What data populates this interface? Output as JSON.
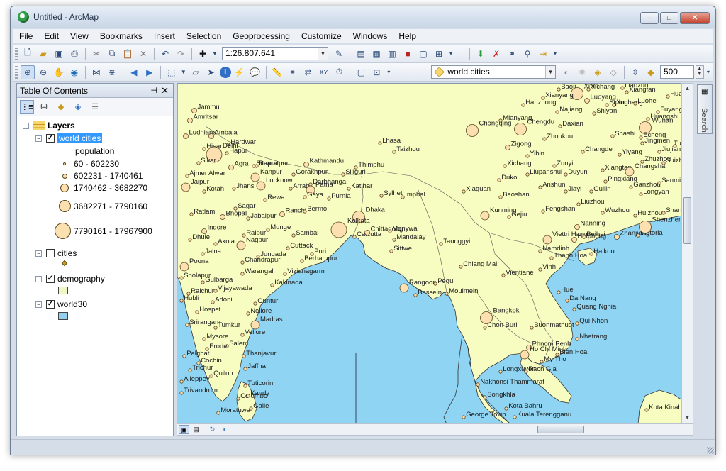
{
  "window": {
    "title": "Untitled - ArcMap",
    "minimize": "–",
    "maximize": "□",
    "close": "✕"
  },
  "menu": [
    "File",
    "Edit",
    "View",
    "Bookmarks",
    "Insert",
    "Selection",
    "Geoprocessing",
    "Customize",
    "Windows",
    "Help"
  ],
  "toolbar": {
    "scale": "1:26.807.641",
    "target_layer": "world cities",
    "snap_value": "500"
  },
  "toc": {
    "title": "Table Of Contents",
    "root": "Layers",
    "layers": [
      {
        "name": "world cities",
        "checked": true,
        "selected": true,
        "legend_title": "population",
        "classes": [
          "60 - 602230",
          "602231 - 1740461",
          "1740462 - 3682270",
          "3682271 - 7790160",
          "7790161 - 17967900"
        ]
      },
      {
        "name": "cities",
        "checked": false
      },
      {
        "name": "demography",
        "checked": true,
        "color": "#f0f7c4"
      },
      {
        "name": "world30",
        "checked": true,
        "color": "#96ceef"
      }
    ]
  },
  "search_tab": "Search",
  "colors": {
    "land": "#f7fcc0",
    "water": "#8fd4f2",
    "city_fill": "#fde0b0",
    "city_outline": "#5b4420",
    "boundary": "#333333"
  },
  "map_cities": [
    {
      "name": "Jammu",
      "size": 1
    },
    {
      "name": "Amritsar",
      "size": 1
    },
    {
      "name": "Ludhiana",
      "size": 1
    },
    {
      "name": "Ambala",
      "size": 1
    },
    {
      "name": "Hardwar",
      "size": 0
    },
    {
      "name": "Hisar",
      "size": 0
    },
    {
      "name": "Hapur",
      "size": 0
    },
    {
      "name": "Delhi",
      "size": 4
    },
    {
      "name": "Agra",
      "size": 1
    },
    {
      "name": "Sikar",
      "size": 0
    },
    {
      "name": "Bharatpur",
      "size": 0
    },
    {
      "name": "Jaipur",
      "size": 2
    },
    {
      "name": "Ajmer Alwar",
      "size": 0
    },
    {
      "name": "Kotah",
      "size": 0
    },
    {
      "name": "Jhansi",
      "size": 0
    },
    {
      "name": "Kanpur",
      "size": 2
    },
    {
      "name": "Lucknow",
      "size": 2
    },
    {
      "name": "Gorakhpur",
      "size": 0
    },
    {
      "name": "Kathmandu",
      "size": 1
    },
    {
      "name": "Siliguri",
      "size": 0
    },
    {
      "name": "Thimphu",
      "size": 0
    },
    {
      "name": "Lhasa",
      "size": 0
    },
    {
      "name": "Taizhou",
      "size": 0
    },
    {
      "name": "Sitapur",
      "size": 0
    },
    {
      "name": "Arrah",
      "size": 0
    },
    {
      "name": "Darbhanga",
      "size": 0
    },
    {
      "name": "Patna",
      "size": 2
    },
    {
      "name": "Katihar",
      "size": 0
    },
    {
      "name": "Gaya",
      "size": 0
    },
    {
      "name": "Purnia",
      "size": 0
    },
    {
      "name": "Rewa",
      "size": 0
    },
    {
      "name": "Ranchi",
      "size": 1
    },
    {
      "name": "Bermo",
      "size": 0
    },
    {
      "name": "Sylhet",
      "size": 0
    },
    {
      "name": "Imphal",
      "size": 0
    },
    {
      "name": "Dhaka",
      "size": 3
    },
    {
      "name": "Kolkata",
      "size": 4
    },
    {
      "name": "Calcutta",
      "size": 0
    },
    {
      "name": "Chittagong",
      "size": 1
    },
    {
      "name": "Ratlam",
      "size": 0
    },
    {
      "name": "Bhopal",
      "size": 1
    },
    {
      "name": "Jabalpur",
      "size": 0
    },
    {
      "name": "Sagar",
      "size": 0
    },
    {
      "name": "Indore",
      "size": 1
    },
    {
      "name": "Raipur",
      "size": 0
    },
    {
      "name": "Munge",
      "size": 0
    },
    {
      "name": "Sambal",
      "size": 0
    },
    {
      "name": "Nagpur",
      "size": 2
    },
    {
      "name": "Akola",
      "size": 0
    },
    {
      "name": "Cuttack",
      "size": 0
    },
    {
      "name": "Jungada",
      "size": 0
    },
    {
      "name": "Puri",
      "size": 0
    },
    {
      "name": "Berhampur",
      "size": 0
    },
    {
      "name": "Chandrapur",
      "size": 0
    },
    {
      "name": "Dhule",
      "size": 0
    },
    {
      "name": "Jalna",
      "size": 0
    },
    {
      "name": "Poona",
      "size": 2
    },
    {
      "name": "Warangal",
      "size": 0
    },
    {
      "name": "Vizianagarm",
      "size": 0
    },
    {
      "name": "Sholapur",
      "size": 0
    },
    {
      "name": "Gulbarga",
      "size": 0
    },
    {
      "name": "Vijayawada",
      "size": 0
    },
    {
      "name": "Kakinada",
      "size": 0
    },
    {
      "name": "Raichur",
      "size": 0
    },
    {
      "name": "Guntur",
      "size": 0
    },
    {
      "name": "Hubli",
      "size": 0
    },
    {
      "name": "Adoni",
      "size": 0
    },
    {
      "name": "Nellore",
      "size": 0
    },
    {
      "name": "Hospet",
      "size": 0
    },
    {
      "name": "Madras",
      "size": 2
    },
    {
      "name": "Srirangam",
      "size": 0
    },
    {
      "name": "Tumkur",
      "size": 0
    },
    {
      "name": "Vellore",
      "size": 0
    },
    {
      "name": "Mysore",
      "size": 0
    },
    {
      "name": "Salem",
      "size": 0
    },
    {
      "name": "Erode",
      "size": 0
    },
    {
      "name": "Palghat",
      "size": 0
    },
    {
      "name": "Thanjavur",
      "size": 0
    },
    {
      "name": "Cochin",
      "size": 0
    },
    {
      "name": "Trichur",
      "size": 0
    },
    {
      "name": "Jaffna",
      "size": 0
    },
    {
      "name": "Quilon",
      "size": 0
    },
    {
      "name": "Alleppey",
      "size": 0
    },
    {
      "name": "Tuticorin",
      "size": 0
    },
    {
      "name": "Trivandrum",
      "size": 0
    },
    {
      "name": "Colombo",
      "size": 0
    },
    {
      "name": "Kandy",
      "size": 0
    },
    {
      "name": "Moratuwa",
      "size": 0
    },
    {
      "name": "Galle",
      "size": 0
    },
    {
      "name": "Monywa",
      "size": 0
    },
    {
      "name": "Mandalay",
      "size": 0
    },
    {
      "name": "Sittwe",
      "size": 0
    },
    {
      "name": "Taunggyi",
      "size": 0
    },
    {
      "name": "Rangoon",
      "size": 2
    },
    {
      "name": "Bassein",
      "size": 0
    },
    {
      "name": "Pegu",
      "size": 0
    },
    {
      "name": "Moulmein",
      "size": 0
    },
    {
      "name": "Chiang Mai",
      "size": 0
    },
    {
      "name": "Vientiane",
      "size": 0
    },
    {
      "name": "Bangkok",
      "size": 3
    },
    {
      "name": "Chon Buri",
      "size": 0
    },
    {
      "name": "Hue",
      "size": 0
    },
    {
      "name": "Da Nang",
      "size": 0
    },
    {
      "name": "Quang Nghia",
      "size": 0
    },
    {
      "name": "Qui Nhon",
      "size": 0
    },
    {
      "name": "Buonmathuot",
      "size": 0
    },
    {
      "name": "Nhatrang",
      "size": 0
    },
    {
      "name": "Phnom Penh",
      "size": 1
    },
    {
      "name": "Bien Hoa",
      "size": 0
    },
    {
      "name": "Ho Chi Minh",
      "size": 2
    },
    {
      "name": "My Tho",
      "size": 0
    },
    {
      "name": "Longxuyen",
      "size": 0
    },
    {
      "name": "Rach Gia",
      "size": 0
    },
    {
      "name": "Nakhonsi Thammarat",
      "size": 0
    },
    {
      "name": "Songkhla",
      "size": 0
    },
    {
      "name": "Kota Bahru",
      "size": 0
    },
    {
      "name": "Kuala Terengganu",
      "size": 0
    },
    {
      "name": "George Town",
      "size": 0
    },
    {
      "name": "Kota Kinabalu",
      "size": 0
    },
    {
      "name": "Viettri Hanoi",
      "size": 2
    },
    {
      "name": "Namdinh",
      "size": 0
    },
    {
      "name": "Haiphong",
      "size": 1
    },
    {
      "name": "Thanh Hoa",
      "size": 0
    },
    {
      "name": "Vinh",
      "size": 0
    },
    {
      "name": "Beihai",
      "size": 0
    },
    {
      "name": "Zhanjiang",
      "size": 1
    },
    {
      "name": "Haikou",
      "size": 0
    },
    {
      "name": "Victoria",
      "size": 0
    },
    {
      "name": "Kunming",
      "size": 2
    },
    {
      "name": "Gejiu",
      "size": 0
    },
    {
      "name": "Xiaguan",
      "size": 0
    },
    {
      "name": "Baoshan",
      "size": 0
    },
    {
      "name": "Dukou",
      "size": 0
    },
    {
      "name": "Xichang",
      "size": 0
    },
    {
      "name": "Zigong",
      "size": 1
    },
    {
      "name": "Yibin",
      "size": 0
    },
    {
      "name": "Chongqing",
      "size": 3
    },
    {
      "name": "Chengdu",
      "size": 3
    },
    {
      "name": "Mianyang",
      "size": 0
    },
    {
      "name": "Zhoukou",
      "size": 0
    },
    {
      "name": "Daxian",
      "size": 0
    },
    {
      "name": "Hanzhong",
      "size": 0
    },
    {
      "name": "Baoji",
      "size": 0
    },
    {
      "name": "Xi'an",
      "size": 3
    },
    {
      "name": "Yichang",
      "size": 0
    },
    {
      "name": "Xianyang",
      "size": 0
    },
    {
      "name": "Luoyang",
      "size": 1
    },
    {
      "name": "Najiang",
      "size": 0
    },
    {
      "name": "Shiyan",
      "size": 0
    },
    {
      "name": "Xiangfan",
      "size": 0
    },
    {
      "name": "Shashi",
      "size": 0
    },
    {
      "name": "Jingmen",
      "size": 0
    },
    {
      "name": "Wuhan",
      "size": 3
    },
    {
      "name": "Zhuzhou",
      "size": 0
    },
    {
      "name": "Changde",
      "size": 0
    },
    {
      "name": "Yiyang",
      "size": 0
    },
    {
      "name": "Xiangtan",
      "size": 0
    },
    {
      "name": "Changsha",
      "size": 2
    },
    {
      "name": "Pingxiang",
      "size": 0
    },
    {
      "name": "Zunyi",
      "size": 0
    },
    {
      "name": "Duyun",
      "size": 0
    },
    {
      "name": "Liupanshui",
      "size": 0
    },
    {
      "name": "Anshun",
      "size": 0
    },
    {
      "name": "Jiayi",
      "size": 0
    },
    {
      "name": "Guilin",
      "size": 0
    },
    {
      "name": "Liuzhou",
      "size": 0
    },
    {
      "name": "Fengshan",
      "size": 0
    },
    {
      "name": "Wuzhou",
      "size": 0
    },
    {
      "name": "Nanning",
      "size": 1
    },
    {
      "name": "Ganzhou",
      "size": 0
    },
    {
      "name": "Longyan",
      "size": 0
    },
    {
      "name": "Sanming",
      "size": 0
    },
    {
      "name": "Huizhou",
      "size": 0
    },
    {
      "name": "Shantou",
      "size": 0
    },
    {
      "name": "Shenzhen",
      "size": 3
    },
    {
      "name": "Jiujiang",
      "size": 0
    },
    {
      "name": "Suizhou",
      "size": 0
    },
    {
      "name": "Fuyang",
      "size": 0
    },
    {
      "name": "Huaibei",
      "size": 0
    },
    {
      "name": "Liaozuo",
      "size": 0
    },
    {
      "name": "Xuchang",
      "size": 0
    },
    {
      "name": "Luohe",
      "size": 0
    },
    {
      "name": "Huangshi",
      "size": 0
    },
    {
      "name": "Echeng",
      "size": 0
    },
    {
      "name": "Tunxi",
      "size": 0
    },
    {
      "name": "Siping",
      "size": 0
    }
  ]
}
